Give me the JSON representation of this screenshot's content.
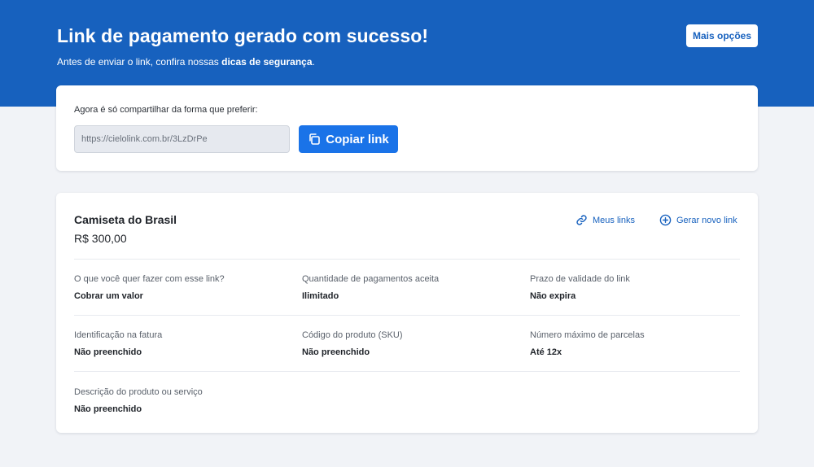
{
  "header": {
    "title": "Link de pagamento gerado com sucesso!",
    "subtitle_pre": "Antes de enviar o link, confira nossas ",
    "subtitle_link": "dicas de segurança",
    "subtitle_post": ".",
    "more_button": "Mais opções",
    "background_color": "#1761be"
  },
  "share": {
    "label": "Agora é só compartilhar da forma que preferir:",
    "link_value": "https://cielolink.com.br/3LzDrPe",
    "copy_button": "Copiar link",
    "copy_icon": "copy-icon",
    "button_color": "#1a73e8"
  },
  "product": {
    "name": "Camiseta do Brasil",
    "price": "R$ 300,00",
    "actions": {
      "my_links": "Meus links",
      "my_links_icon": "link-icon",
      "new_link": "Gerar novo link",
      "new_link_icon": "plus-circle-icon"
    },
    "fields": [
      {
        "label": "O que você quer fazer com esse link?",
        "value": "Cobrar um valor"
      },
      {
        "label": "Quantidade de pagamentos aceita",
        "value": "Ilimitado"
      },
      {
        "label": "Prazo de validade do link",
        "value": "Não expira"
      },
      {
        "label": "Identificação na fatura",
        "value": "Não preenchido"
      },
      {
        "label": "Código do produto (SKU)",
        "value": "Não preenchido"
      },
      {
        "label": "Número máximo de parcelas",
        "value": "Até 12x"
      },
      {
        "label": "Descrição do produto ou serviço",
        "value": "Não preenchido"
      }
    ]
  }
}
